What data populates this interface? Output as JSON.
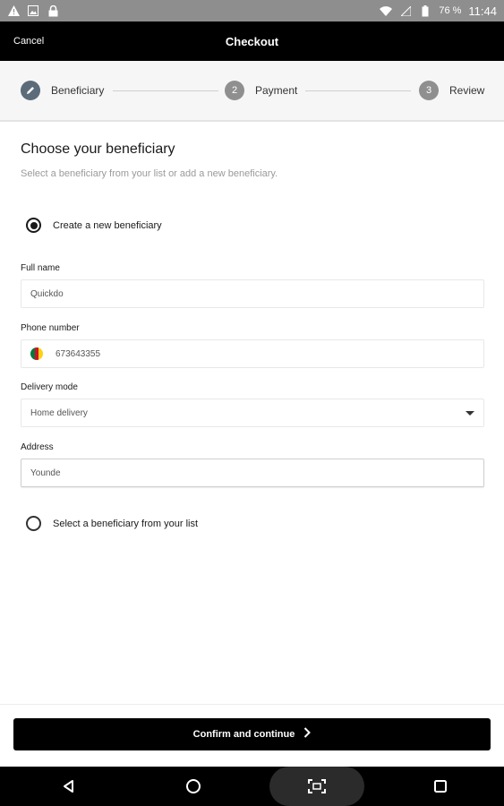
{
  "status_bar": {
    "battery_pct": "76 %",
    "time": "11:44",
    "left_icons": [
      "warning-icon",
      "image-icon",
      "lock-icon"
    ],
    "right_icons": [
      "wifi-icon",
      "signal-icon",
      "battery-icon"
    ]
  },
  "top_bar": {
    "cancel_label": "Cancel",
    "title": "Checkout"
  },
  "stepper": {
    "steps": [
      {
        "number": "",
        "label": "Beneficiary",
        "icon": "pencil-icon",
        "active": true
      },
      {
        "number": "2",
        "label": "Payment",
        "active": false
      },
      {
        "number": "3",
        "label": "Review",
        "active": false
      }
    ]
  },
  "main": {
    "heading": "Choose your beneficiary",
    "subheading": "Select a beneficiary from your list or add a new beneficiary.",
    "option_new": {
      "label": "Create a new beneficiary",
      "selected": true
    },
    "full_name": {
      "label": "Full name",
      "value": "Quickdo"
    },
    "phone": {
      "label": "Phone number",
      "value": "673643355",
      "flag_colors": [
        "#007a3d",
        "#ce1126",
        "#fcd116"
      ]
    },
    "delivery_mode": {
      "label": "Delivery mode",
      "value": "Home delivery"
    },
    "address": {
      "label": "Address",
      "value": "Younde"
    },
    "option_list": {
      "label": "Select a beneficiary from your list",
      "selected": false
    }
  },
  "footer": {
    "cta_label": "Confirm and continue"
  },
  "colors": {
    "primary": "#000000",
    "active_step": "#5b6b79",
    "inactive_step": "#8f8f8f",
    "status_bar": "#8e8e8e"
  }
}
